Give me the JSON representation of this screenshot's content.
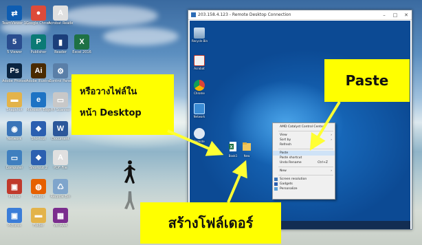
{
  "host_desktop": {
    "icons": [
      {
        "name": "teamviewer",
        "label": "TeamViewer 12",
        "color": "#0e5db2",
        "glyph": "⇄"
      },
      {
        "name": "chrome",
        "label": "Google Chrome",
        "color": "#dd4b39",
        "glyph": "●"
      },
      {
        "name": "acrobat",
        "label": "Acrobat Reader",
        "color": "#e0e0e0",
        "glyph": "A"
      },
      {
        "name": "app5",
        "label": "5 Viewer",
        "color": "#2a4d8f",
        "glyph": "5"
      },
      {
        "name": "publisher",
        "label": "Publisher",
        "color": "#0b7a75",
        "glyph": "P"
      },
      {
        "name": "book",
        "label": "Reader",
        "color": "#1b3e7a",
        "glyph": "▮"
      },
      {
        "name": "excel",
        "label": "Excel 2016",
        "color": "#1e7145",
        "glyph": "X"
      },
      {
        "name": "photoshop",
        "label": "Adobe Photoshop",
        "color": "#0a2440",
        "glyph": "Ps"
      },
      {
        "name": "illustrator",
        "label": "Adobe Illustrator",
        "color": "#4a2a00",
        "glyph": "Ai"
      },
      {
        "name": "control-panel",
        "label": "Control Panel",
        "color": "#5a7fa8",
        "glyph": "⚙"
      },
      {
        "name": "folder1",
        "label": "Snapshot",
        "color": "#e3b34a",
        "glyph": "▬"
      },
      {
        "name": "edge",
        "label": "Microsoft Edge",
        "color": "#1e73c4",
        "glyph": "e"
      },
      {
        "name": "printer",
        "label": "HP Scanner",
        "color": "#c8c8c8",
        "glyph": "▭"
      },
      {
        "name": "network",
        "label": "Network",
        "color": "#3a74b8",
        "glyph": "◉"
      },
      {
        "name": "app-blue",
        "label": "Shortcut",
        "color": "#2b5fb0",
        "glyph": "❖"
      },
      {
        "name": "word",
        "label": "Document",
        "color": "#2b579a",
        "glyph": "W"
      },
      {
        "name": "monitor",
        "label": "Computer",
        "color": "#3f7fbf",
        "glyph": "▭"
      },
      {
        "name": "app-blue-2",
        "label": "Shortcut 2",
        "color": "#2b5fb0",
        "glyph": "❖"
      },
      {
        "name": "pdf2",
        "label": "PDF File",
        "color": "#e0e0e0",
        "glyph": "A"
      },
      {
        "name": "photos",
        "label": "Photos",
        "color": "#c0392b",
        "glyph": "▣"
      },
      {
        "name": "firefox",
        "label": "Firefox",
        "color": "#e66000",
        "glyph": "◍"
      },
      {
        "name": "recycle",
        "label": "Recycle Bin",
        "color": "#7fa5cc",
        "glyph": "♺"
      },
      {
        "name": "pictures",
        "label": "Pictures",
        "color": "#3b7dd8",
        "glyph": "▣"
      },
      {
        "name": "folder2",
        "label": "Folder",
        "color": "#e3b34a",
        "glyph": "▬"
      },
      {
        "name": "winrar",
        "label": "WinRAR",
        "color": "#7b2d8e",
        "glyph": "▦"
      }
    ]
  },
  "remote_window": {
    "title": "203.158.4.123 - Remote Desktop Connection",
    "controls": [
      "–",
      "□",
      "✕"
    ],
    "icons": [
      {
        "name": "recycle-bin",
        "label": "Recycle Bin"
      },
      {
        "name": "acrobat",
        "label": "Acrobat"
      },
      {
        "name": "chrome",
        "label": "Chrome"
      },
      {
        "name": "network",
        "label": "Network"
      },
      {
        "name": "teamviewer",
        "label": "Remote"
      }
    ],
    "new_files": [
      {
        "name": "excel-file",
        "label": "Book1"
      },
      {
        "name": "new-folder",
        "label": "New"
      }
    ]
  },
  "context_menu": {
    "items": [
      {
        "label": "AMD Catalyst Control Center",
        "sep_after": true
      },
      {
        "label": "View",
        "arrow": "›"
      },
      {
        "label": "Sort by",
        "arrow": "›"
      },
      {
        "label": "Refresh",
        "sep_after": true
      },
      {
        "label": "Paste",
        "highlight": true
      },
      {
        "label": "Paste shortcut"
      },
      {
        "label": "Undo Rename",
        "shortcut": "Ctrl+Z",
        "sep_after": true
      },
      {
        "label": "New",
        "arrow": "›",
        "sep_after": true
      },
      {
        "label": "Screen resolution"
      },
      {
        "label": "Gadgets"
      },
      {
        "label": "Personalize"
      }
    ]
  },
  "callouts": {
    "drop_hint_line1": "หรือวางไฟล์ใน",
    "drop_hint_line2": "หน้า Desktop",
    "paste": "Paste",
    "create_folder": "สร้างโฟล์เดอร์"
  },
  "colors": {
    "callout": "#ffff00",
    "arrow": "#ffff33",
    "menu_highlight": "#cfe3f7"
  }
}
